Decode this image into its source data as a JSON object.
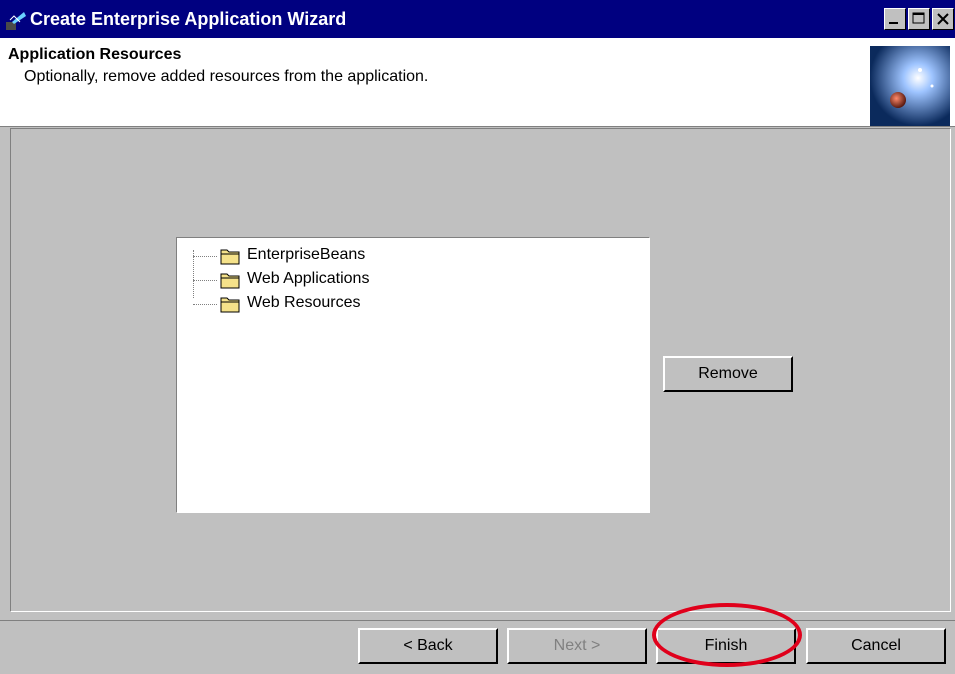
{
  "window": {
    "title": "Create Enterprise Application Wizard",
    "icon": "java-app-icon",
    "controls": [
      "minimize-icon",
      "maximize-icon",
      "close-icon"
    ]
  },
  "header": {
    "title": "Application Resources",
    "subtitle": "Optionally, remove added resources from the application."
  },
  "tree": {
    "items": [
      {
        "label": "EnterpriseBeans",
        "icon": "folder-icon"
      },
      {
        "label": "Web Applications",
        "icon": "folder-icon"
      },
      {
        "label": "Web Resources",
        "icon": "folder-icon"
      }
    ]
  },
  "buttons": {
    "remove": "Remove",
    "back": "< Back",
    "next": "Next >",
    "finish": "Finish",
    "cancel": "Cancel"
  },
  "colors": {
    "titlebar": "#000080",
    "panel": "#c0c0c0",
    "highlight": "#e0001b"
  }
}
